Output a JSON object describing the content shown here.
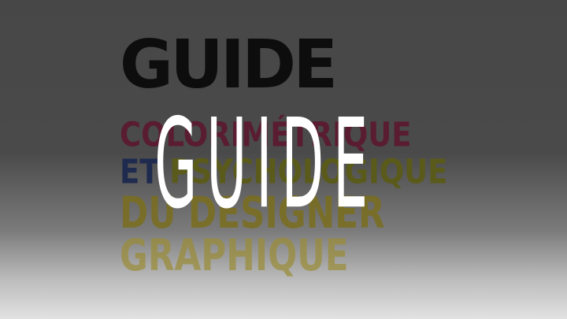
{
  "background_text": {
    "title": "GUIDE",
    "line1": "COLORIMÉTRIQUE",
    "line2_et": "ET ",
    "line2_rest": "PSYCHOLOGIQUE",
    "line3": "DU DESIGNER",
    "line4": "GRAPHIQUE"
  },
  "overlay_text": {
    "title": "GUIDE"
  },
  "colors": {
    "background_top": "#474747",
    "background_bottom": "#e2e2e2",
    "title_dark": "#0d0d0d",
    "line1": "#5a1a30",
    "line2_et": "#1f2a4f",
    "line2_rest": "#5a5a1a",
    "line3": "#7a6e1e",
    "line4": "#9a8c35",
    "overlay_title": "#ffffff"
  }
}
